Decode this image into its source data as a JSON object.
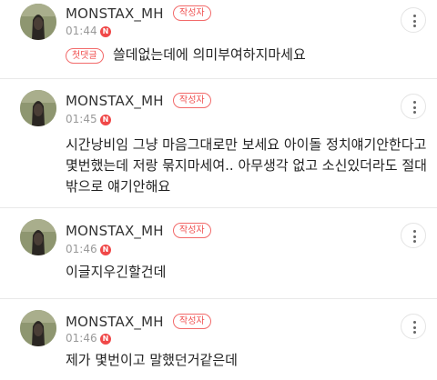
{
  "comments": [
    {
      "username": "MONSTAX_MH",
      "author_badge": "작성자",
      "time": "01:44",
      "new_badge": "N",
      "first_reply_badge": "첫댓글",
      "lines": [
        "쓸데없는데에 의미부여하지마세요"
      ]
    },
    {
      "username": "MONSTAX_MH",
      "author_badge": "작성자",
      "time": "01:45",
      "new_badge": "N",
      "lines": [
        "시간낭비임 그냥 마음그대로만 보세요 아이돌 정치얘기안한다고",
        "몇번했는데 저랑 묶지마세여.. 아무생각 없고 소신있더라도 절대",
        "밖으로 얘기안해요"
      ]
    },
    {
      "username": "MONSTAX_MH",
      "author_badge": "작성자",
      "time": "01:46",
      "new_badge": "N",
      "lines": [
        "이글지우긴할건데"
      ]
    },
    {
      "username": "MONSTAX_MH",
      "author_badge": "작성자",
      "time": "01:46",
      "new_badge": "N",
      "lines": [
        "제가 몇번이고 말했던거같은데"
      ]
    }
  ],
  "icons": {
    "more": "more-vertical-icon",
    "avatar": "profile-avatar"
  },
  "colors": {
    "accent": "#f04848",
    "text": "#222222",
    "meta": "#9a9a9a"
  }
}
